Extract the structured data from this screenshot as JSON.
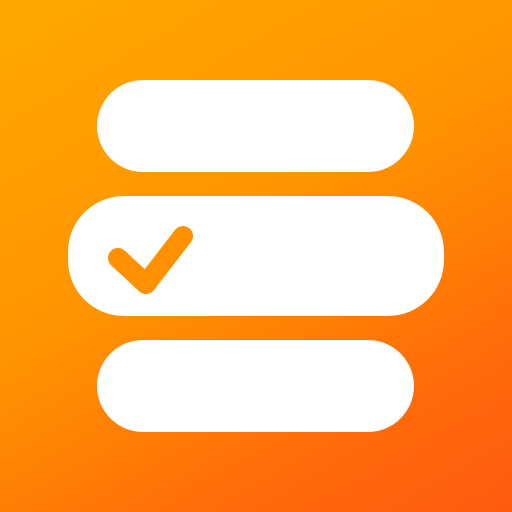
{
  "app_icon": {
    "name": "checklist-app-icon",
    "colors": {
      "gradient_start": "#FFA800",
      "gradient_end": "#FF5A10",
      "bar": "#FFFFFF",
      "check": "#FF9100"
    },
    "items": [
      {
        "icon": "none",
        "checked": false
      },
      {
        "icon": "checkmark-icon",
        "checked": true
      },
      {
        "icon": "none",
        "checked": false
      }
    ]
  }
}
